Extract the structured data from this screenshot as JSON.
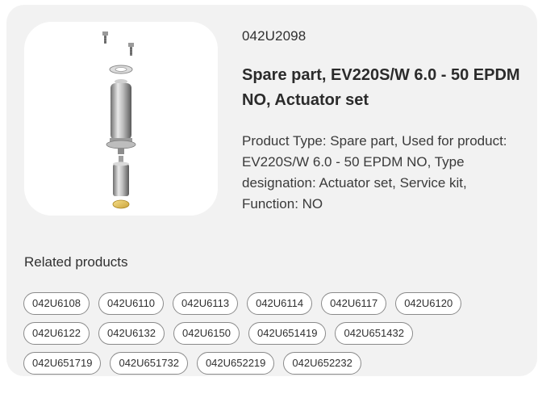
{
  "product": {
    "image_alt": "actuator-set-product-image",
    "sku": "042U2098",
    "title": "Spare part, EV220S/W 6.0 - 50 EPDM NO, Actuator set",
    "description": "Product Type: Spare part, Used for product: EV220S/W 6.0 - 50 EPDM NO, Type designation: Actuator set, Service kit, Function: NO"
  },
  "related": {
    "heading": "Related products",
    "rows": [
      [
        "042U6108",
        "042U6110",
        "042U6113",
        "042U6114",
        "042U6117",
        "042U6120"
      ],
      [
        "042U6122",
        "042U6132",
        "042U6150",
        "042U651419",
        "042U651432"
      ],
      [
        "042U651719",
        "042U651732",
        "042U652219",
        "042U652232"
      ]
    ]
  },
  "colors": {
    "card_background": "#f2f2f2",
    "chip_border": "#8a8a8a",
    "text": "#303030"
  }
}
